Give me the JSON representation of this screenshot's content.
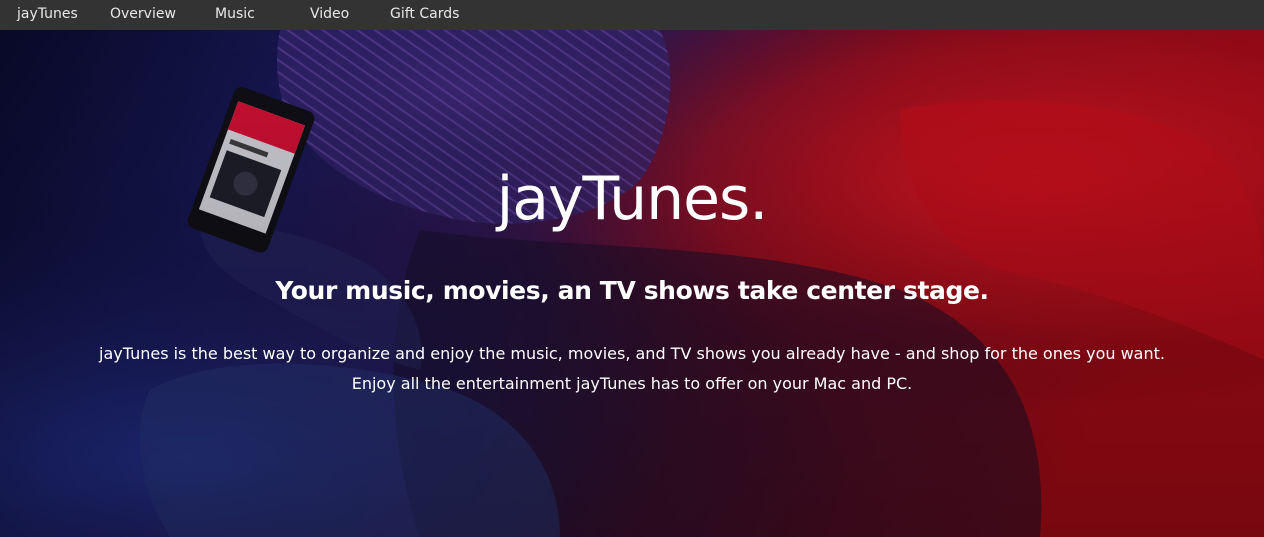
{
  "nav": {
    "brand": "jayTunes",
    "items": [
      {
        "label": "Overview"
      },
      {
        "label": "Music"
      },
      {
        "label": "Video"
      },
      {
        "label": "Gift Cards"
      }
    ]
  },
  "hero": {
    "title": "jayTunes.",
    "subtitle": "Your music, movies, an TV shows take center stage.",
    "description_line1": "jayTunes is the best way to organize and enjoy the music, movies, and TV shows you already have - and shop for the ones you want.",
    "description_line2": "Enjoy all the entertainment jayTunes has to offer on your Mac and PC."
  },
  "colors": {
    "navbar": "#333333",
    "hero_blue": "#1a1e7a",
    "hero_red": "#e0101e",
    "text": "#ffffff"
  }
}
